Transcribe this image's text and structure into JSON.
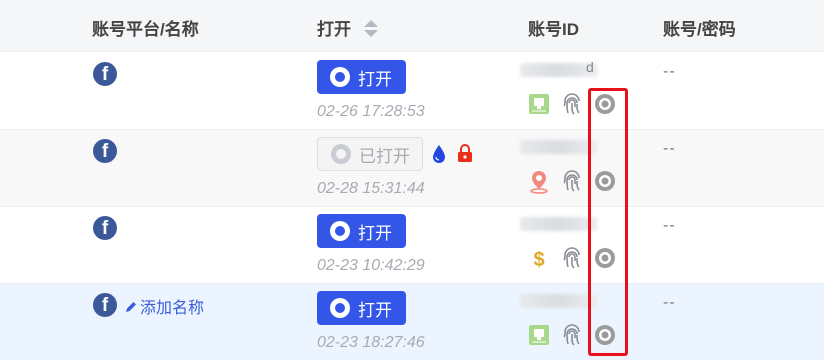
{
  "columns": {
    "platform_name": "账号平台/名称",
    "open": "打开",
    "account_id": "账号ID",
    "account_password": "账号/密码"
  },
  "rows": [
    {
      "platform_icon": "facebook-icon",
      "name_action": "",
      "button_label": "打开",
      "button_state": "enabled",
      "timestamp": "02-26 17:28:53",
      "id_suffix": "d",
      "status_icons": [
        "green-device-icon",
        "fingerprint-icon",
        "circle-target-icon"
      ],
      "password": "--"
    },
    {
      "platform_icon": "facebook-icon",
      "name_action": "",
      "button_label": "已打开",
      "button_state": "disabled",
      "timestamp": "02-28 15:31:44",
      "id_suffix": "",
      "status_icons": [
        "location-pin-icon",
        "fingerprint-icon",
        "circle-target-icon"
      ],
      "password": "--"
    },
    {
      "platform_icon": "facebook-icon",
      "name_action": "",
      "button_label": "打开",
      "button_state": "enabled",
      "timestamp": "02-23 10:42:29",
      "id_suffix": "",
      "status_icons": [
        "dollar-icon",
        "fingerprint-icon",
        "circle-target-icon"
      ],
      "password": "--"
    },
    {
      "platform_icon": "facebook-icon",
      "name_action": "添加名称",
      "button_label": "打开",
      "button_state": "enabled",
      "timestamp": "02-23 18:27:46",
      "id_suffix": "",
      "status_icons": [
        "green-device-icon",
        "fingerprint-icon",
        "circle-target-icon"
      ],
      "password": "--"
    }
  ],
  "colors": {
    "primary": "#3456e8",
    "facebook": "#3b5998",
    "highlight": "#e8111b"
  }
}
